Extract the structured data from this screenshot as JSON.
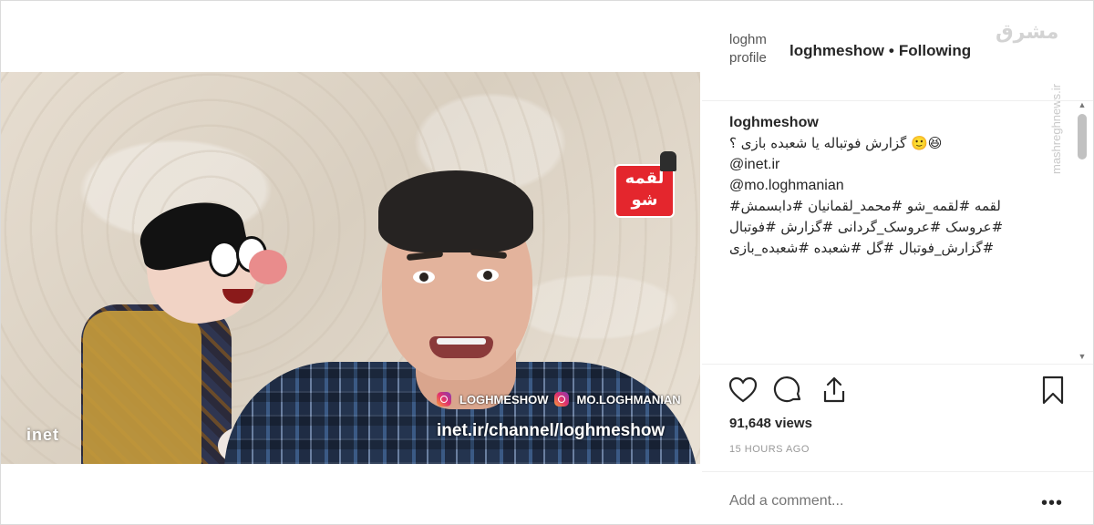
{
  "video": {
    "channel_tags": [
      "LOGHMESHOW",
      "MO.LOGHMANIAN"
    ],
    "channel_url": "inet.ir/channel/loghmeshow",
    "inet_mark": "inet",
    "logo_text": "لقمه شو"
  },
  "header": {
    "avatar_alt_lines": [
      "loghm",
      "profile"
    ],
    "username": "loghmeshow",
    "separator": "•",
    "follow_state": "Following",
    "watermark": "مشرق",
    "watermark_vertical": "mashreghnews.ir"
  },
  "caption": {
    "username": "loghmeshow",
    "line1": "😆🙂 گزارش فوتباله یا شعبده بازی ؟",
    "mention1": "@inet.ir",
    "mention2": "@mo.loghmanian",
    "tags1": "لقمه #لقمه_شو #محمد_لقمانیان #دابسمش#",
    "tags2": "#عروسک #عروسک_گردانی #گزارش #فوتبال",
    "tags3": "#گزارش_فوتبال #گل #شعبده #شعبده_بازی"
  },
  "actions": {
    "like_icon": "heart-icon",
    "comment_icon": "comment-icon",
    "share_icon": "share-icon",
    "save_icon": "bookmark-icon"
  },
  "stats": {
    "views": "91,648 views",
    "time": "15 HOURS AGO"
  },
  "comment": {
    "placeholder": "Add a comment...",
    "more": "•••"
  }
}
